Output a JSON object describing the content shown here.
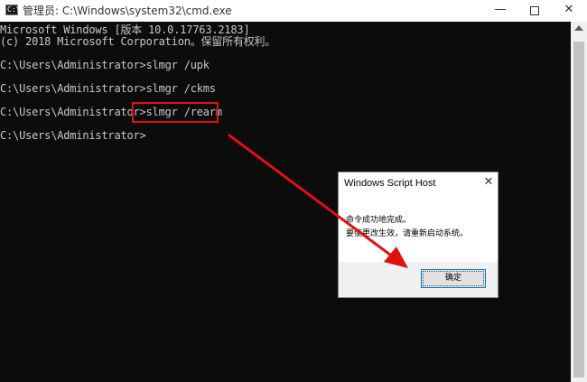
{
  "window": {
    "title": "管理员: C:\\Windows\\system32\\cmd.exe",
    "icon": "cmd-icon",
    "icon_text": "C:\\",
    "minimize_label": "—",
    "close_label": "✕"
  },
  "console": {
    "lines": [
      "Microsoft Windows [版本 10.0.17763.2183]",
      "(c) 2018 Microsoft Corporation。保留所有权利。",
      "",
      "C:\\Users\\Administrator>slmgr /upk",
      "",
      "C:\\Users\\Administrator>slmgr /ckms",
      "",
      "C:\\Users\\Administrator>slmgr /rearm",
      "",
      "C:\\Users\\Administrator>"
    ]
  },
  "dialog": {
    "title": "Windows Script Host",
    "close_label": "✕",
    "message_line1": "命令成功地完成。",
    "message_line2": "要使更改生效，请重新启动系统。",
    "ok_label": "确定"
  },
  "annotation": {
    "color": "#e01010"
  }
}
